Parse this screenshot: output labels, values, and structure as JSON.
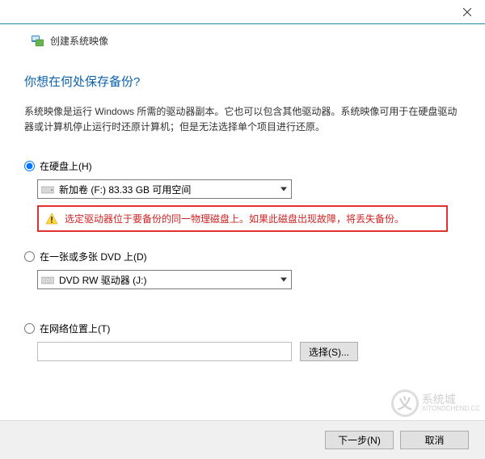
{
  "header": {
    "title": "创建系统映像"
  },
  "page": {
    "title": "你想在何处保存备份?",
    "desc": "系统映像是运行 Windows 所需的驱动器副本。它也可以包含其他驱动器。系统映像可用于在硬盘驱动器或计算机停止运行时还原计算机；但是无法选择单个项目进行还原。"
  },
  "options": {
    "disk": {
      "label": "在硬盘上(H)",
      "selected": "新加卷 (F:)  83.33 GB 可用空间",
      "warning": "选定驱动器位于要备份的同一物理磁盘上。如果此磁盘出现故障，将丢失备份。"
    },
    "dvd": {
      "label": "在一张或多张 DVD 上(D)",
      "selected": "DVD RW 驱动器 (J:)"
    },
    "network": {
      "label": "在网络位置上(T)",
      "value": "",
      "select_btn": "选择(S)..."
    }
  },
  "footer": {
    "next": "下一步(N)",
    "cancel": "取消"
  },
  "watermark": {
    "logo": "义",
    "line1": "系统城",
    "line2": "XITONDCHEND.CC"
  }
}
